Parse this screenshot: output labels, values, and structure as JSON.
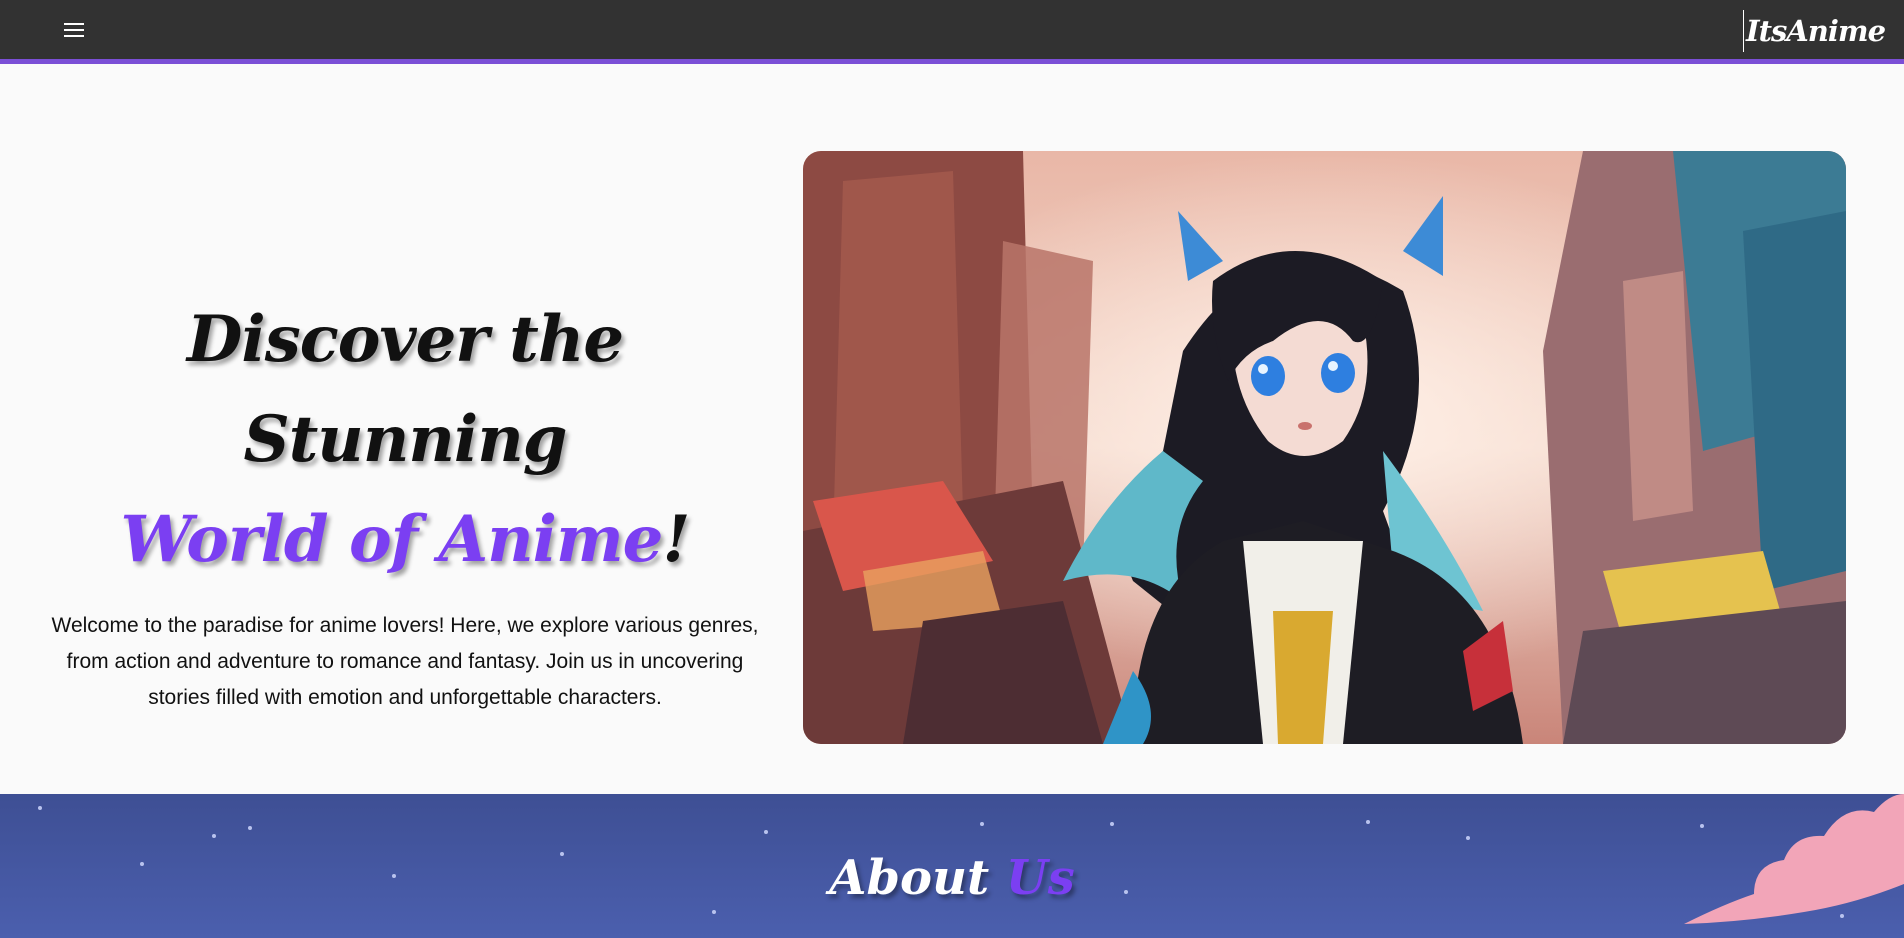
{
  "navbar": {
    "menu_icon": "hamburger-menu-icon",
    "brand": "ItsAnime",
    "colors": {
      "background": "#323232",
      "accent_border": "#7b4fd6",
      "text": "#ffffff"
    }
  },
  "hero": {
    "title_line1": "Discover the Stunning",
    "title_accent": "World of Anime",
    "title_suffix": "!",
    "description": "Welcome to the paradise for anime lovers! Here, we explore various genres, from action and adventure to romance and fantasy. Join us in uncovering stories filled with emotion and unforgettable characters.",
    "image": "anime-girl-cat-ears-city-illustration",
    "colors": {
      "accent": "#7b3ff2",
      "text": "#111111"
    }
  },
  "about": {
    "title_word1": "About",
    "title_accent": "Us",
    "colors": {
      "background_top": "#3e4f94",
      "background_bottom": "#4b5fae",
      "cloud": "#f2a5b8"
    }
  }
}
